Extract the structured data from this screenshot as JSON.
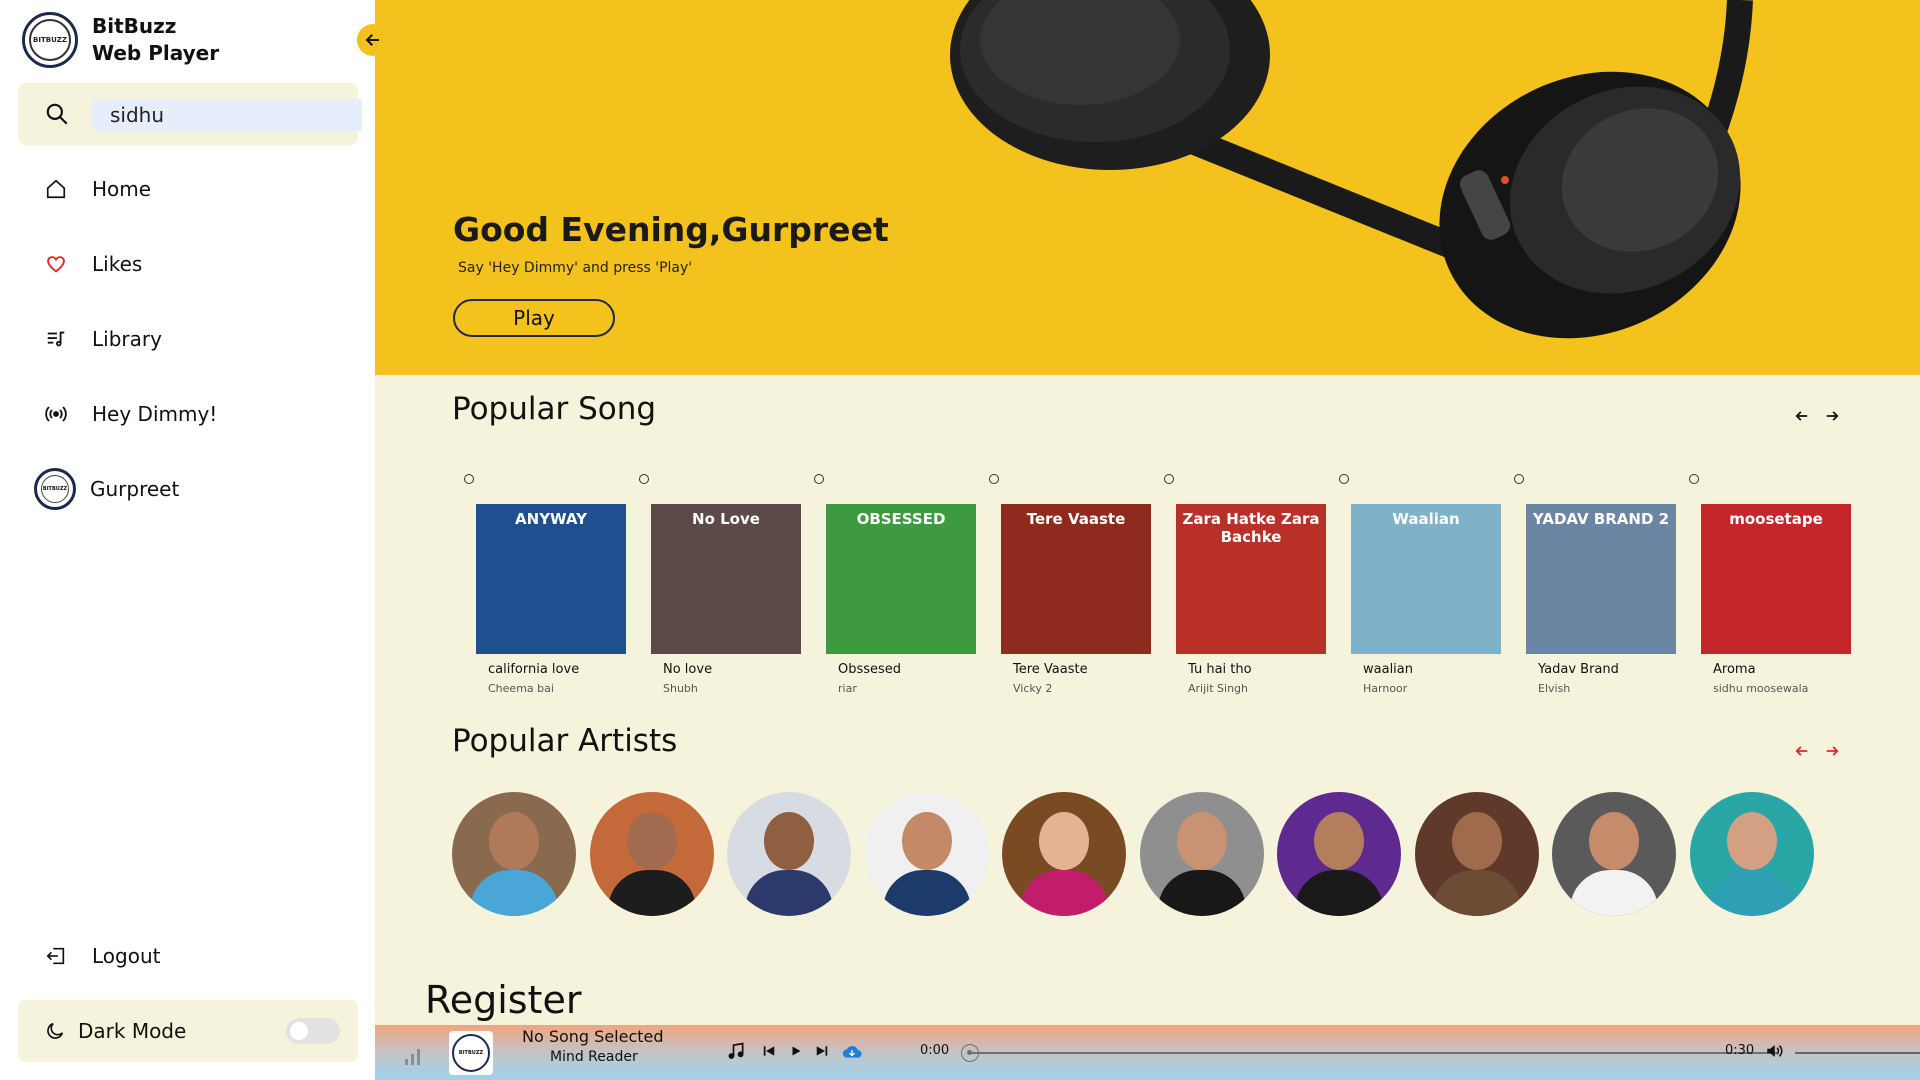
{
  "brand": {
    "line1": "BitBuzz",
    "line2": "Web Player",
    "logo_text": "BITBUZZ"
  },
  "search": {
    "value": "sidhu",
    "placeholder": ""
  },
  "nav": {
    "home": "Home",
    "likes": "Likes",
    "library": "Library",
    "hey_dimmy": "Hey Dimmy!",
    "profile": "Gurpreet",
    "logout": "Logout"
  },
  "dark_mode": {
    "label": "Dark Mode",
    "enabled": false
  },
  "hero": {
    "title": "Good Evening,Gurpreet",
    "subtitle": "Say 'Hey Dimmy' and press 'Play'",
    "play_label": "Play"
  },
  "popular_songs": {
    "title": "Popular Song",
    "prev_icon": "arrow-left-icon",
    "next_icon": "arrow-right-icon",
    "items": [
      {
        "name": "california love",
        "artist": "Cheema bai",
        "cover_text": "ANYWAY",
        "color": "#1f4f8f"
      },
      {
        "name": "No love",
        "artist": "Shubh",
        "cover_text": "No Love",
        "color": "#5c4a48"
      },
      {
        "name": "Obssesed",
        "artist": "riar",
        "cover_text": "OBSESSED",
        "color": "#3e9a3f"
      },
      {
        "name": "Tere Vaaste",
        "artist": "Vicky 2",
        "cover_text": "Tere Vaaste",
        "color": "#8f2b1e"
      },
      {
        "name": "Tu hai tho",
        "artist": "Arijit Singh",
        "cover_text": "Zara Hatke Zara Bachke",
        "color": "#b83028"
      },
      {
        "name": "waalian",
        "artist": "Harnoor",
        "cover_text": "Waalian",
        "color": "#7fb1c9"
      },
      {
        "name": "Yadav Brand",
        "artist": "Elvish",
        "cover_text": "YADAV BRAND 2",
        "color": "#6b86a3"
      },
      {
        "name": "Aroma",
        "artist": "sidhu moosewala",
        "cover_text": "moosetape",
        "color": "#c5262b"
      }
    ]
  },
  "popular_artists": {
    "title": "Popular Artists",
    "prev_icon": "arrow-left-icon",
    "next_icon": "arrow-right-icon",
    "arrow_color": "#e0242a",
    "items": [
      {
        "bg": "#8a6a4e",
        "skin": "#b07a5a",
        "shirt": "#4aa6d6"
      },
      {
        "bg": "#c46a3a",
        "skin": "#a26b4f",
        "shirt": "#1d1d1d"
      },
      {
        "bg": "#d7dbe4",
        "skin": "#8f5f42",
        "shirt": "#2b3a6b"
      },
      {
        "bg": "#f0f0f0",
        "skin": "#c48a67",
        "shirt": "#1c3a6a"
      },
      {
        "bg": "#7a4a23",
        "skin": "#e4b392",
        "shirt": "#c21d6a"
      },
      {
        "bg": "#8f8f8f",
        "skin": "#c99272",
        "shirt": "#181818"
      },
      {
        "bg": "#5e2a8f",
        "skin": "#b37e5c",
        "shirt": "#1a1a1a"
      },
      {
        "bg": "#5f3a2a",
        "skin": "#a06a4c",
        "shirt": "#6e4b35"
      },
      {
        "bg": "#5a5a5a",
        "skin": "#c48c6b",
        "shirt": "#f2f2f2"
      },
      {
        "bg": "#2aa6a6",
        "skin": "#d4a084",
        "shirt": "#2f9fb5"
      }
    ]
  },
  "register": {
    "title": "Register"
  },
  "player": {
    "title": "No Song Selected",
    "artist": "Mind Reader",
    "current_time": "0:00",
    "duration": "0:30",
    "progress": 0,
    "logo_text": "BITBUZZ"
  },
  "colors": {
    "accent": "#f4c21c",
    "sidebar_bg": "#ffffff",
    "content_bg": "#f6f3dc",
    "likes_heart": "#e0242a",
    "download": "#1e7fd8"
  }
}
